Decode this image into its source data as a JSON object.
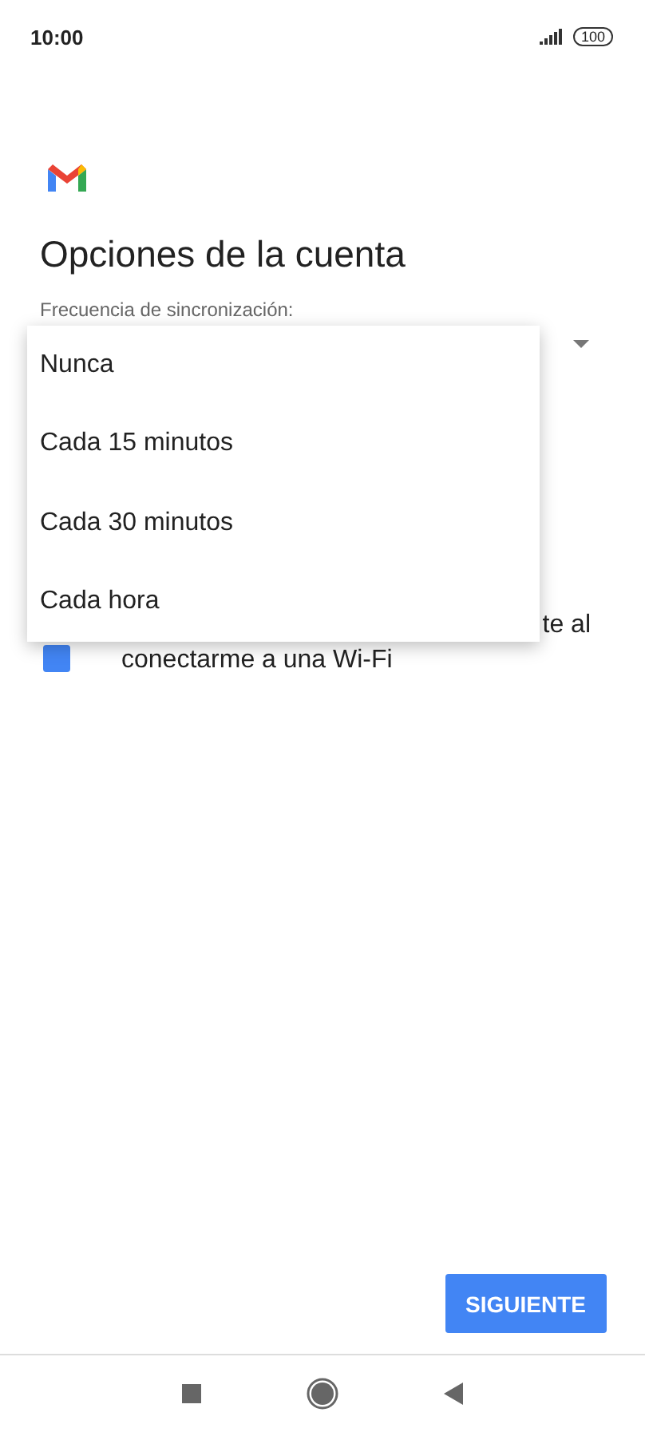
{
  "status_bar": {
    "time": "10:00",
    "battery": "100"
  },
  "title": "Opciones de la cuenta",
  "sync_field": {
    "label": "Frecuencia de sincronización:"
  },
  "settings": [
    {
      "text_line_1": "te al",
      "text_line_2": "conectarme a una Wi-Fi",
      "kind": "checkbox",
      "checked": true
    }
  ],
  "menu": {
    "items": [
      {
        "label": "Nunca"
      },
      {
        "label": "Cada 15 minutos"
      },
      {
        "label": "Cada 30 minutos"
      },
      {
        "label": "Cada hora"
      }
    ]
  },
  "next_button": "SIGUIENTE"
}
